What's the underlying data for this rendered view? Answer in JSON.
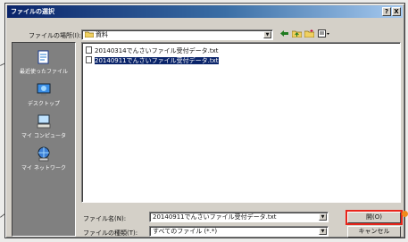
{
  "dialog": {
    "title": "ファイルの選択",
    "title_buttons": {
      "help": "?",
      "close": "X"
    }
  },
  "location": {
    "label": "ファイルの場所(I):",
    "value": "資料"
  },
  "toolbar_icons": [
    "back-icon",
    "up-folder-icon",
    "new-folder-icon",
    "view-menu-icon"
  ],
  "places": [
    {
      "label": "最近使ったファイル",
      "icon": "recent-files-icon"
    },
    {
      "label": "デスクトップ",
      "icon": "desktop-icon"
    },
    {
      "label": "マイ コンピュータ",
      "icon": "my-computer-icon"
    },
    {
      "label": "マイ ネットワーク",
      "icon": "network-icon"
    }
  ],
  "files": [
    {
      "name": "20140314でんさいファイル受付データ.txt",
      "selected": false
    },
    {
      "name": "20140911でんさいファイル受付データ.txt",
      "selected": true
    }
  ],
  "filename": {
    "label": "ファイル名(N):",
    "value": "20140911でんさいファイル受付データ.txt"
  },
  "filetype": {
    "label": "ファイルの種類(T):",
    "value": "すべてのファイル (*.*)"
  },
  "buttons": {
    "open": "開(O)",
    "cancel": "キャンセル"
  },
  "colors": {
    "highlight": "#e8251b",
    "marker": "#f08a1c",
    "selection": "#0a246a",
    "title_start": "#0a246a"
  }
}
